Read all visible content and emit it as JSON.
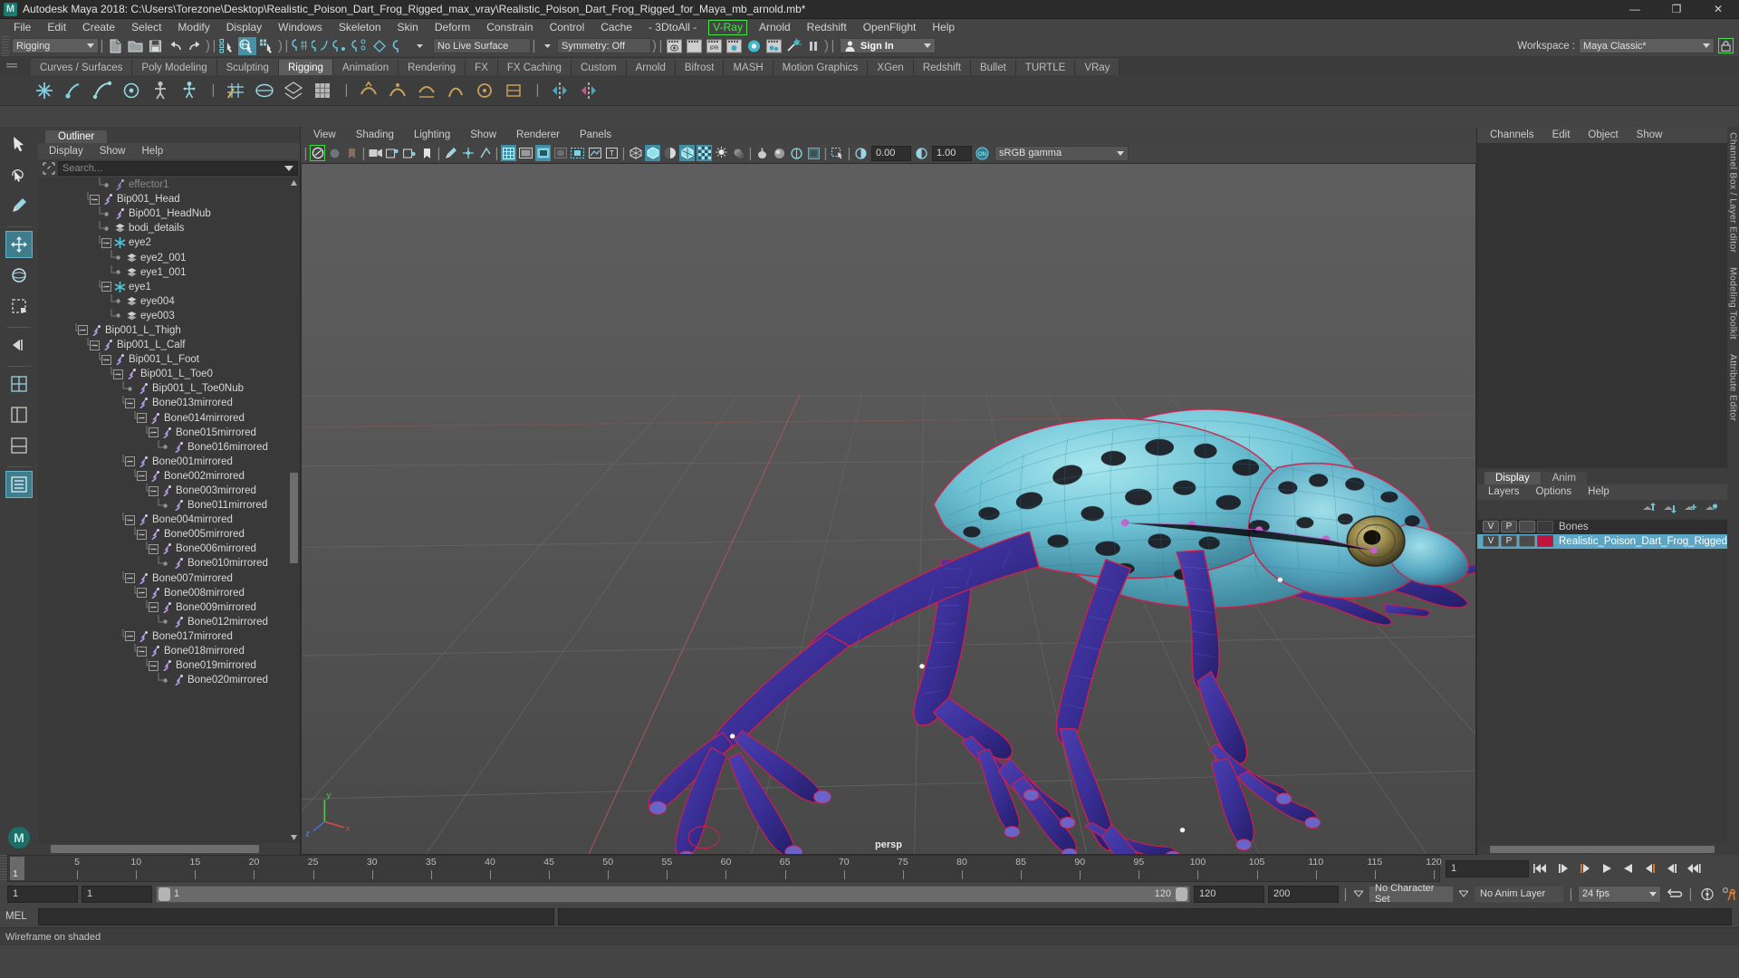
{
  "window": {
    "title": "Autodesk Maya 2018: C:\\Users\\Torezone\\Desktop\\Realistic_Poison_Dart_Frog_Rigged_max_vray\\Realistic_Poison_Dart_Frog_Rigged_for_Maya_mb_arnold.mb*",
    "logo": "M",
    "minimize": "—",
    "maximize": "❐",
    "close": "✕"
  },
  "menubar": {
    "items": [
      "File",
      "Edit",
      "Create",
      "Select",
      "Modify",
      "Display",
      "Windows",
      "Skeleton",
      "Skin",
      "Deform",
      "Constrain",
      "Control",
      "Cache",
      "- 3DtoAll -"
    ],
    "highlighted": "V-Ray",
    "after": [
      "Arnold",
      "Redshift",
      "OpenFlight",
      "Help"
    ]
  },
  "statusline": {
    "menuset": "Rigging",
    "live_surface": "No Live Surface",
    "symmetry": "Symmetry: Off",
    "sign_in": "Sign In",
    "workspace_label": "Workspace :",
    "workspace_value": "Maya Classic*",
    "lock_icon": "lock-icon"
  },
  "shelf": {
    "tabs": [
      "Curves / Surfaces",
      "Poly Modeling",
      "Sculpting",
      "Rigging",
      "Animation",
      "Rendering",
      "FX",
      "FX Caching",
      "Custom",
      "Arnold",
      "Bifrost",
      "MASH",
      "Motion Graphics",
      "XGen",
      "Redshift",
      "Bullet",
      "TURTLE",
      "VRay"
    ],
    "active": "Rigging"
  },
  "outliner": {
    "tab": "Outliner",
    "menu": [
      "Display",
      "Show",
      "Help"
    ],
    "search_placeholder": "Search...",
    "tree": [
      {
        "label": "effector1",
        "depth": 5,
        "type": "effector",
        "expander": "leaf",
        "dim": true
      },
      {
        "label": "Bip001_Head",
        "depth": 4,
        "type": "joint",
        "expander": "minus"
      },
      {
        "label": "Bip001_HeadNub",
        "depth": 5,
        "type": "joint",
        "expander": "leaf"
      },
      {
        "label": "bodi_details",
        "depth": 5,
        "type": "mesh",
        "expander": "leaf"
      },
      {
        "label": "eye2",
        "depth": 5,
        "type": "star",
        "expander": "minus"
      },
      {
        "label": "eye2_001",
        "depth": 6,
        "type": "mesh",
        "expander": "leaf"
      },
      {
        "label": "eye1_001",
        "depth": 6,
        "type": "mesh",
        "expander": "leaf"
      },
      {
        "label": "eye1",
        "depth": 5,
        "type": "star",
        "expander": "minus"
      },
      {
        "label": "eye004",
        "depth": 6,
        "type": "mesh",
        "expander": "leaf"
      },
      {
        "label": "eye003",
        "depth": 6,
        "type": "mesh",
        "expander": "leaf"
      },
      {
        "label": "Bip001_L_Thigh",
        "depth": 3,
        "type": "joint",
        "expander": "minus"
      },
      {
        "label": "Bip001_L_Calf",
        "depth": 4,
        "type": "joint",
        "expander": "minus"
      },
      {
        "label": "Bip001_L_Foot",
        "depth": 5,
        "type": "joint",
        "expander": "minus"
      },
      {
        "label": "Bip001_L_Toe0",
        "depth": 6,
        "type": "joint",
        "expander": "minus"
      },
      {
        "label": "Bip001_L_Toe0Nub",
        "depth": 7,
        "type": "joint",
        "expander": "leaf"
      },
      {
        "label": "Bone013mirrored",
        "depth": 7,
        "type": "joint",
        "expander": "minus"
      },
      {
        "label": "Bone014mirrored",
        "depth": 8,
        "type": "joint",
        "expander": "minus"
      },
      {
        "label": "Bone015mirrored",
        "depth": 9,
        "type": "joint",
        "expander": "minus"
      },
      {
        "label": "Bone016mirrored",
        "depth": 10,
        "type": "joint",
        "expander": "leaf"
      },
      {
        "label": "Bone001mirrored",
        "depth": 7,
        "type": "joint",
        "expander": "minus"
      },
      {
        "label": "Bone002mirrored",
        "depth": 8,
        "type": "joint",
        "expander": "minus"
      },
      {
        "label": "Bone003mirrored",
        "depth": 9,
        "type": "joint",
        "expander": "minus"
      },
      {
        "label": "Bone011mirrored",
        "depth": 10,
        "type": "joint",
        "expander": "leaf"
      },
      {
        "label": "Bone004mirrored",
        "depth": 7,
        "type": "joint",
        "expander": "minus"
      },
      {
        "label": "Bone005mirrored",
        "depth": 8,
        "type": "joint",
        "expander": "minus"
      },
      {
        "label": "Bone006mirrored",
        "depth": 9,
        "type": "joint",
        "expander": "minus"
      },
      {
        "label": "Bone010mirrored",
        "depth": 10,
        "type": "joint",
        "expander": "leaf"
      },
      {
        "label": "Bone007mirrored",
        "depth": 7,
        "type": "joint",
        "expander": "minus"
      },
      {
        "label": "Bone008mirrored",
        "depth": 8,
        "type": "joint",
        "expander": "minus"
      },
      {
        "label": "Bone009mirrored",
        "depth": 9,
        "type": "joint",
        "expander": "minus"
      },
      {
        "label": "Bone012mirrored",
        "depth": 10,
        "type": "joint",
        "expander": "leaf"
      },
      {
        "label": "Bone017mirrored",
        "depth": 7,
        "type": "joint",
        "expander": "minus"
      },
      {
        "label": "Bone018mirrored",
        "depth": 8,
        "type": "joint",
        "expander": "minus"
      },
      {
        "label": "Bone019mirrored",
        "depth": 9,
        "type": "joint",
        "expander": "minus"
      },
      {
        "label": "Bone020mirrored",
        "depth": 10,
        "type": "joint",
        "expander": "leaf"
      }
    ]
  },
  "viewport": {
    "menu": [
      "View",
      "Shading",
      "Lighting",
      "Show",
      "Renderer",
      "Panels"
    ],
    "exposure": "0.00",
    "gamma": "1.00",
    "colorspace": "sRGB gamma",
    "camera_label": "persp",
    "axis_labels": [
      "y",
      "x",
      "z"
    ]
  },
  "channelbox": {
    "menu": [
      "Channels",
      "Edit",
      "Object",
      "Show"
    ],
    "side_labels": [
      "Channel Box / Layer Editor",
      "Modeling Toolkit",
      "Attribute Editor"
    ]
  },
  "layers": {
    "tabs": [
      "Display",
      "Anim"
    ],
    "active_tab": "Display",
    "menu": [
      "Layers",
      "Options",
      "Help"
    ],
    "rows": [
      {
        "v": "V",
        "p": "P",
        "color": "#3a3a3a",
        "name": "Bones",
        "selected": false
      },
      {
        "v": "V",
        "p": "P",
        "color": "#c0143c",
        "name": "Realistic_Poison_Dart_Frog_Rigged",
        "selected": true
      }
    ]
  },
  "timeline": {
    "current_frame": "1",
    "ticks": [
      5,
      10,
      15,
      20,
      25,
      30,
      35,
      40,
      45,
      50,
      55,
      60,
      65,
      70,
      75,
      80,
      85,
      90,
      95,
      100,
      105,
      110,
      115,
      120
    ],
    "start": 1,
    "end": 120,
    "frame_field": "1"
  },
  "range": {
    "anim_start": "1",
    "range_start": "1",
    "bar_left": "1",
    "bar_right": "120",
    "range_end": "120",
    "anim_end": "200",
    "character_set": "No Character Set",
    "anim_layer": "No Anim Layer",
    "fps": "24 fps"
  },
  "command": {
    "label": "MEL",
    "input_value": "",
    "status": "Wireframe on shaded"
  }
}
